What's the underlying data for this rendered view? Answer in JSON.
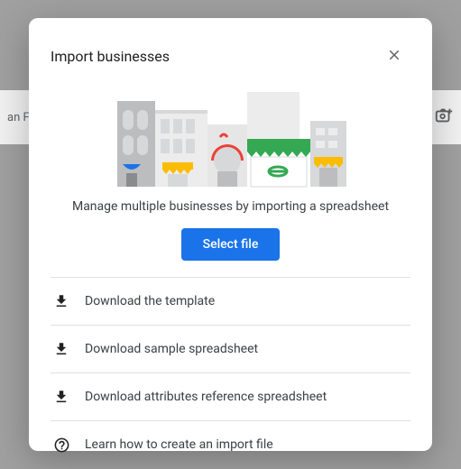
{
  "background": {
    "left_text": "an Fra"
  },
  "dialog": {
    "title": "Import businesses",
    "subtitle": "Manage multiple businesses by importing a spreadsheet",
    "select_button": "Select file",
    "links": [
      {
        "icon": "download",
        "label": "Download the template"
      },
      {
        "icon": "download",
        "label": "Download sample spreadsheet"
      },
      {
        "icon": "download",
        "label": "Download attributes reference spreadsheet"
      },
      {
        "icon": "help",
        "label": "Learn how to create an import file"
      }
    ]
  },
  "colors": {
    "primary": "#1a73e8"
  }
}
